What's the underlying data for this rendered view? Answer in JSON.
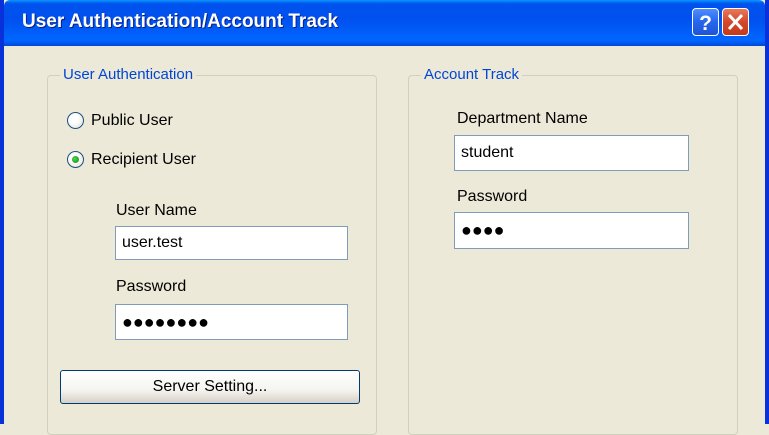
{
  "window": {
    "title": "User Authentication/Account Track"
  },
  "user_auth": {
    "legend": "User Authentication",
    "public_user_label": "Public User",
    "recipient_user_label": "Recipient User",
    "selected": "Recipient User",
    "user_name_label": "User Name",
    "user_name_value": "user.test",
    "password_label": "Password",
    "password_mask": "●●●●●●●●",
    "server_setting_label": "Server Setting..."
  },
  "account_track": {
    "legend": "Account Track",
    "department_name_label": "Department Name",
    "department_name_value": "student",
    "password_label": "Password",
    "password_mask": "●●●●"
  },
  "colors": {
    "title_blue": "#0053ee",
    "legend_blue": "#0046d5",
    "dialog_bg": "#ece9d8",
    "close_red": "#d4482a"
  },
  "icons": {
    "help": "help-icon",
    "close": "close-icon"
  }
}
